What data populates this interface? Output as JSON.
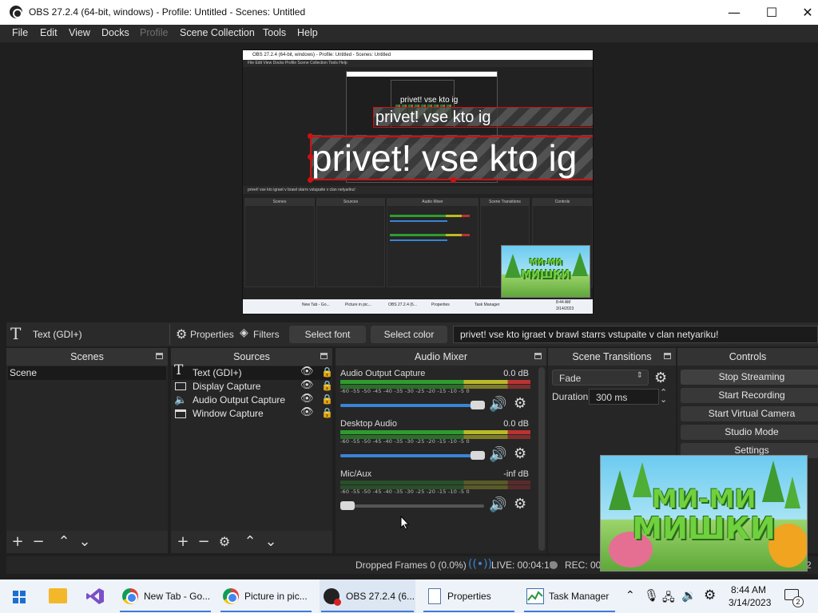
{
  "window": {
    "title": "OBS 27.2.4 (64-bit, windows) - Profile: Untitled - Scenes: Untitled",
    "minimize": "—",
    "maximize": "☐",
    "close": "✕"
  },
  "menu": [
    "File",
    "Edit",
    "View",
    "Docks",
    "Profile",
    "Scene Collection",
    "Tools",
    "Help"
  ],
  "preview": {
    "overlay_text": "privet! vse kto ig",
    "mini_title": "OBS 27.2.4 (64-bit, windows) - Profile: Untitled - Scenes: Untitled",
    "mini_menu": "File  Edit  View  Docks  Profile  Scene Collection  Tools  Help",
    "mini_toolbar": "privet! vse kto igraet v brawl starrs vstupaite v clan netyariku!",
    "mini_docks": [
      "Scenes",
      "Sources",
      "Audio Mixer",
      "Scene Transitions",
      "Controls"
    ],
    "mini_taskbar": [
      "New Tab - Go...",
      "Picture in pic...",
      "OBS 27.2.4 (6...",
      "Properties",
      "Task Manager"
    ],
    "mini_time": "8:44 AM",
    "mini_date": "3/14/2023",
    "logo_top": "МИ-МИ",
    "logo_bottom": "МИШКИ"
  },
  "source_toolbar": {
    "source_name": "Text (GDI+)",
    "properties": "Properties",
    "filters": "Filters",
    "select_font": "Select font",
    "select_color": "Select color",
    "text_value": "privet! vse kto igraet v brawl starrs vstupaite v clan netyariku!"
  },
  "scenes": {
    "title": "Scenes",
    "items": [
      "Scene"
    ]
  },
  "sources": {
    "title": "Sources",
    "items": [
      {
        "name": "Text (GDI+)",
        "icon": "text-icon"
      },
      {
        "name": "Display Capture",
        "icon": "monitor-icon"
      },
      {
        "name": "Audio Output Capture",
        "icon": "speaker-icon"
      },
      {
        "name": "Window Capture",
        "icon": "window-icon"
      }
    ]
  },
  "mixer": {
    "title": "Audio Mixer",
    "scale": "-60 -55 -50 -45 -40 -35 -30 -25 -20 -15 -10 -5 0",
    "channels": [
      {
        "name": "Audio Output Capture",
        "db": "0.0 dB",
        "volume": 0.92
      },
      {
        "name": "Desktop Audio",
        "db": "0.0 dB",
        "volume": 0.92
      },
      {
        "name": "Mic/Aux",
        "db": "-inf dB",
        "volume": 0.0
      }
    ]
  },
  "transitions": {
    "title": "Scene Transitions",
    "selected": "Fade",
    "duration_label": "Duration",
    "duration_value": "300 ms"
  },
  "controls": {
    "title": "Controls",
    "buttons": [
      "Stop Streaming",
      "Start Recording",
      "Start Virtual Camera",
      "Studio Mode",
      "Settings"
    ]
  },
  "status": {
    "dropped": "Dropped Frames 0 (0.0%)",
    "live": "LIVE: 00:04:19",
    "rec": "REC: 00:",
    "extra": "2"
  },
  "pip": {
    "logo_top": "МИ-МИ",
    "logo_bottom": "МИШКИ"
  },
  "taskbar": {
    "apps": [
      "New Tab - Go...",
      "Picture in pic...",
      "OBS 27.2.4 (6...",
      "Properties",
      "Task Manager"
    ],
    "time": "8:44 AM",
    "date": "3/14/2023",
    "notifications": "2"
  },
  "colors": {
    "accent": "#3a84d6",
    "selection_red": "#d01010",
    "dock_bg": "#262626",
    "dock_header": "#333333"
  }
}
